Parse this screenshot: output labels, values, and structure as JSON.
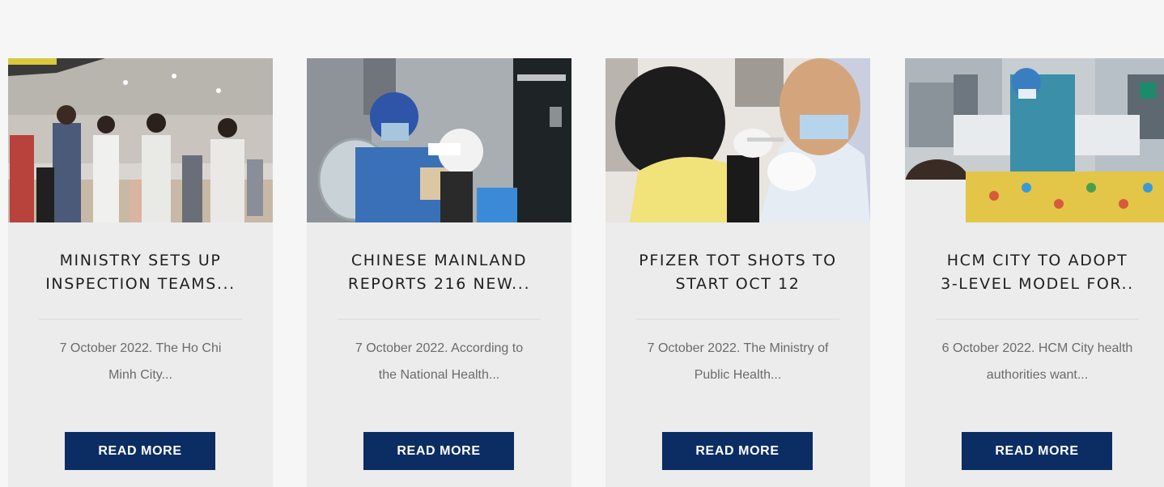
{
  "cards": [
    {
      "title_line1": "MINISTRY SETS UP",
      "title_line2": "INSPECTION TEAMS...",
      "excerpt_line1": "7 October 2022. The Ho Chi",
      "excerpt_line2": "Minh City...",
      "button": "READ MORE"
    },
    {
      "title_line1": "CHINESE MAINLAND",
      "title_line2": "REPORTS 216 NEW...",
      "excerpt_line1": "7 October 2022. According to",
      "excerpt_line2": "the National Health...",
      "button": "READ MORE"
    },
    {
      "title_line1": "PFIZER TOT SHOTS TO",
      "title_line2": "START OCT 12",
      "excerpt_line1": "7 October 2022. The Ministry of",
      "excerpt_line2": "Public Health...",
      "button": "READ MORE"
    },
    {
      "title_line1": "HCM CITY TO ADOPT",
      "title_line2": "3-LEVEL MODEL FOR..",
      "excerpt_line1": "6 October 2022. HCM City health",
      "excerpt_line2": "authorities want...",
      "button": "READ MORE"
    }
  ],
  "colors": {
    "page_background": "#f6f6f6",
    "card_background": "#ececec",
    "button_background": "#0b2d63",
    "button_text": "#ffffff"
  },
  "icons": {
    "card1_image": "airport-officials-photo",
    "card2_image": "covid-testing-photo",
    "card3_image": "child-vaccination-photo",
    "card4_image": "hospital-ward-photo"
  }
}
